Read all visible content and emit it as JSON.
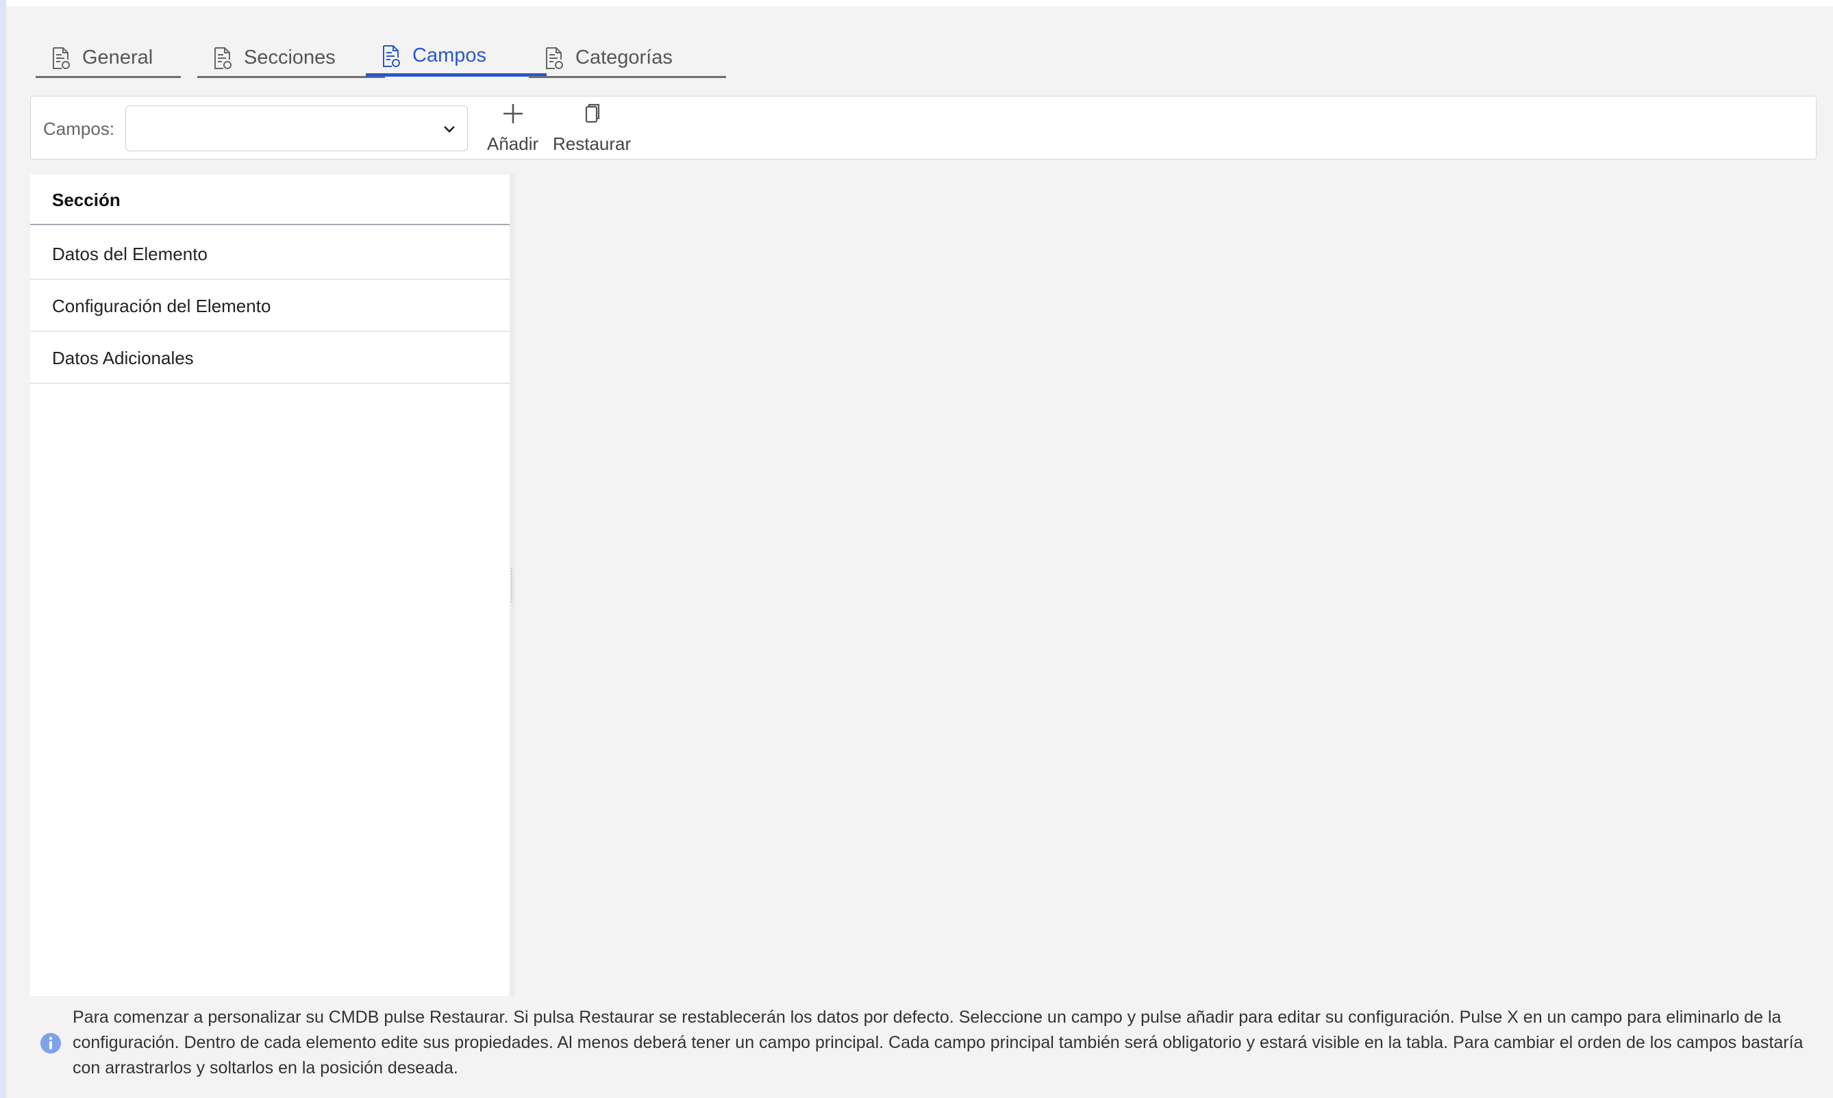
{
  "tabs": [
    {
      "label": "General",
      "icon": "document-settings-icon",
      "active": false
    },
    {
      "label": "Secciones",
      "icon": "document-settings-icon",
      "active": false
    },
    {
      "label": "Campos",
      "icon": "document-settings-icon",
      "active": true
    },
    {
      "label": "Categorías",
      "icon": "document-settings-icon",
      "active": false
    }
  ],
  "toolbar": {
    "fields_label": "Campos:",
    "fields_select_value": "",
    "add_label": "Añadir",
    "restore_label": "Restaurar"
  },
  "section_table": {
    "header": "Sección",
    "rows": [
      "Datos del Elemento",
      "Configuración del Elemento",
      "Datos Adicionales"
    ]
  },
  "info": {
    "icon": "info-circle-icon",
    "text": "Para comenzar a personalizar su CMDB pulse Restaurar. Si pulsa Restaurar se restablecerán los datos por defecto. Seleccione un campo y pulse añadir para editar su configuración. Pulse X en un campo para eliminarlo de la configuración. Dentro de cada elemento edite sus propiedades. Al menos deberá tener un campo principal. Cada campo principal también será obligatorio y estará visible en la tabla. Para cambiar el orden de los campos bastaría con arrastrarlos y soltarlos en la posición deseada."
  },
  "colors": {
    "accent": "#2a57c9",
    "background": "#f3f3f3",
    "info_icon": "#7fa0ea"
  }
}
